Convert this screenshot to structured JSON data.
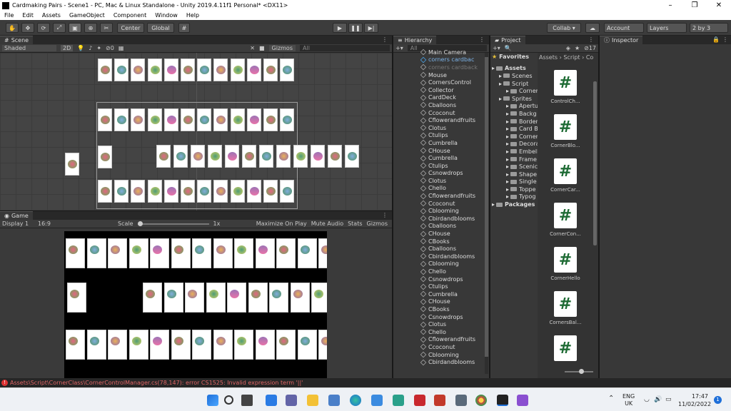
{
  "window": {
    "title": "Cardmaking Pairs - Scene1 - PC, Mac & Linux Standalone - Unity 2019.4.11f1 Personal* <DX11>",
    "minimize": "–",
    "maximize": "❐",
    "close": "✕"
  },
  "menu": [
    "File",
    "Edit",
    "Assets",
    "GameObject",
    "Component",
    "Window",
    "Help"
  ],
  "toolbar": {
    "pivot": "Center",
    "space": "Global",
    "collab": "Collab ▾",
    "account": "Account",
    "layers": "Layers",
    "layout": "2 by 3"
  },
  "scene": {
    "tab": "Scene",
    "shading": "Shaded",
    "mode2d": "2D",
    "gizmos": "Gizmos",
    "search_placeholder": "All",
    "hidden_count": "0"
  },
  "game": {
    "tab": "Game",
    "display": "Display 1",
    "aspect": "16:9",
    "scale_label": "Scale",
    "scale_value": "1x",
    "maximize": "Maximize On Play",
    "mute": "Mute Audio",
    "stats": "Stats",
    "gizmos": "Gizmos"
  },
  "hierarchy": {
    "tab": "Hierarchy",
    "search_placeholder": "All",
    "items": [
      {
        "name": "Main Camera",
        "state": "normal"
      },
      {
        "name": "corners cardbac",
        "state": "prefab"
      },
      {
        "name": "corners cardback",
        "state": "disabled"
      },
      {
        "name": "Mouse",
        "state": "normal"
      },
      {
        "name": "CornersControl",
        "state": "normal"
      },
      {
        "name": "Collector",
        "state": "normal"
      },
      {
        "name": "CardDeck",
        "state": "normal"
      },
      {
        "name": "Cballoons",
        "state": "normal"
      },
      {
        "name": "Ccoconut",
        "state": "normal"
      },
      {
        "name": "Cflowerandfruits",
        "state": "normal"
      },
      {
        "name": "Clotus",
        "state": "normal"
      },
      {
        "name": "Ctulips",
        "state": "normal"
      },
      {
        "name": "Cumbrella",
        "state": "normal"
      },
      {
        "name": "CHouse",
        "state": "normal"
      },
      {
        "name": "Cumbrella",
        "state": "normal"
      },
      {
        "name": "Ctulips",
        "state": "normal"
      },
      {
        "name": "Csnowdrops",
        "state": "normal"
      },
      {
        "name": "Clotus",
        "state": "normal"
      },
      {
        "name": "Chello",
        "state": "normal"
      },
      {
        "name": "Cflowerandfruits",
        "state": "normal"
      },
      {
        "name": "Ccoconut",
        "state": "normal"
      },
      {
        "name": "Cblooming",
        "state": "normal"
      },
      {
        "name": "Cbirdandblooms",
        "state": "normal"
      },
      {
        "name": "Cballoons",
        "state": "normal"
      },
      {
        "name": "CHouse",
        "state": "normal"
      },
      {
        "name": "CBooks",
        "state": "normal"
      },
      {
        "name": "Cballoons",
        "state": "normal"
      },
      {
        "name": "Cbirdandblooms",
        "state": "normal"
      },
      {
        "name": "Cblooming",
        "state": "normal"
      },
      {
        "name": "Chello",
        "state": "normal"
      },
      {
        "name": "Csnowdrops",
        "state": "normal"
      },
      {
        "name": "Ctulips",
        "state": "normal"
      },
      {
        "name": "Cumbrella",
        "state": "normal"
      },
      {
        "name": "CHouse",
        "state": "normal"
      },
      {
        "name": "CBooks",
        "state": "normal"
      },
      {
        "name": "Csnowdrops",
        "state": "normal"
      },
      {
        "name": "Clotus",
        "state": "normal"
      },
      {
        "name": "Chello",
        "state": "normal"
      },
      {
        "name": "Cflowerandfruits",
        "state": "normal"
      },
      {
        "name": "Ccoconut",
        "state": "normal"
      },
      {
        "name": "Cblooming",
        "state": "normal"
      },
      {
        "name": "Cbirdandblooms",
        "state": "normal"
      }
    ]
  },
  "project": {
    "tab": "Project",
    "count": "17",
    "favorites": "Favorites",
    "breadcrumb": [
      "Assets",
      "Script",
      "Co"
    ],
    "tree": [
      {
        "name": "Assets",
        "depth": 0
      },
      {
        "name": "Scenes",
        "depth": 1
      },
      {
        "name": "Script",
        "depth": 1
      },
      {
        "name": "Corner",
        "depth": 2
      },
      {
        "name": "Sprites",
        "depth": 1
      },
      {
        "name": "Apertu",
        "depth": 2
      },
      {
        "name": "Backg",
        "depth": 2
      },
      {
        "name": "Border",
        "depth": 2
      },
      {
        "name": "Card B",
        "depth": 2
      },
      {
        "name": "Corner",
        "depth": 2
      },
      {
        "name": "Decora",
        "depth": 2
      },
      {
        "name": "Embell",
        "depth": 2
      },
      {
        "name": "Frame",
        "depth": 2
      },
      {
        "name": "Scenic",
        "depth": 2
      },
      {
        "name": "Shape",
        "depth": 2
      },
      {
        "name": "Single",
        "depth": 2
      },
      {
        "name": "Toppe",
        "depth": 2
      },
      {
        "name": "Typog",
        "depth": 2
      },
      {
        "name": "Packages",
        "depth": 0
      }
    ],
    "assets": [
      "ControlCh...",
      "CornerBlo...",
      "CornerCar...",
      "CornerCon...",
      "CornerHello",
      "CornersBal...",
      ""
    ]
  },
  "inspector": {
    "tab": "Inspector"
  },
  "status": {
    "message": "Assets\\Script\\CornerClass\\CornerControlManager.cs(78,147): error CS1525: Invalid expression term '||'"
  },
  "taskbar": {
    "lang": "ENG",
    "region": "UK",
    "time": "17:47",
    "date": "11/02/2022",
    "badge": "1"
  }
}
